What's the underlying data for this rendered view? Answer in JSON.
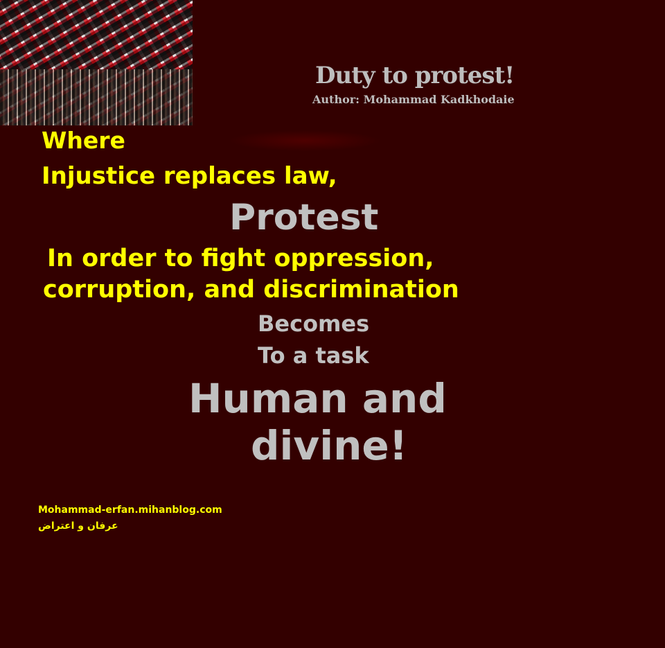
{
  "header": {
    "title": "Duty to protest!",
    "author": "Author: Mohammad Kadkhodaie"
  },
  "photo": {
    "description_icon": "protest-crowd-flags-photo"
  },
  "poem": {
    "line1": "Where",
    "line2": "Injustice replaces law,",
    "line3": "Protest",
    "line4": "In order to fight oppression,",
    "line5": "corruption, and discrimination",
    "line6": "Becomes",
    "line7": "To a task",
    "line8": "Human and",
    "line9": "divine!"
  },
  "footer": {
    "website": "Mohammad-erfan.mihanblog.com",
    "persian_caption": "عرفان و اعتراض"
  },
  "colors": {
    "background": "#330000",
    "accent_yellow": "#ffff00",
    "gray_text": "#c0c0c0"
  }
}
